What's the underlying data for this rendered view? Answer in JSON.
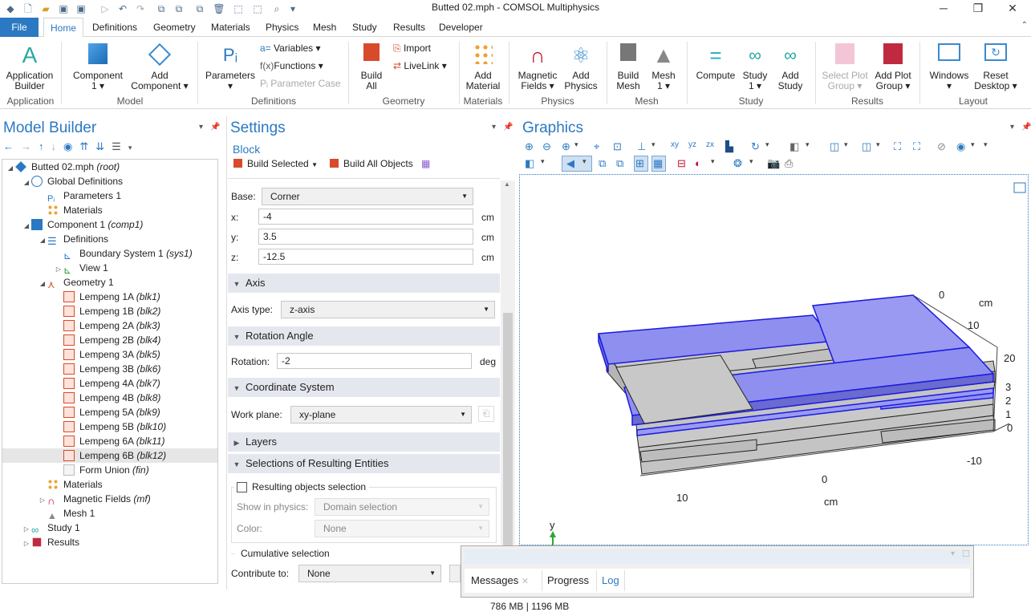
{
  "window": {
    "title": "Butted 02.mph - COMSOL Multiphysics",
    "minimize": "─",
    "restore": "❐",
    "close": "✕"
  },
  "menu": {
    "file": "File",
    "tabs": [
      "Home",
      "Definitions",
      "Geometry",
      "Materials",
      "Physics",
      "Mesh",
      "Study",
      "Results",
      "Developer"
    ]
  },
  "ribbon": {
    "buttons": {
      "app_builder": "Application\nBuilder",
      "component": "Component\n1 ▾",
      "add_component": "Add\nComponent ▾",
      "parameters": "Parameters\n▾",
      "variables": "Variables ▾",
      "functions": "Functions ▾",
      "parameter_case": "Parameter Case",
      "build_all": "Build\nAll",
      "import": "Import",
      "livelink": "LiveLink ▾",
      "add_material": "Add\nMaterial",
      "magnetic_fields": "Magnetic\nFields ▾",
      "add_physics": "Add\nPhysics",
      "build_mesh": "Build\nMesh",
      "mesh1": "Mesh\n1 ▾",
      "compute": "Compute",
      "study1": "Study\n1 ▾",
      "add_study": "Add\nStudy",
      "select_plot_group": "Select Plot\nGroup ▾",
      "add_plot_group": "Add Plot\nGroup ▾",
      "windows": "Windows\n▾",
      "reset_desktop": "Reset\nDesktop ▾"
    },
    "groups": [
      "Application",
      "Model",
      "Definitions",
      "Geometry",
      "Materials",
      "Physics",
      "Mesh",
      "Study",
      "Results",
      "Layout"
    ]
  },
  "model_builder": {
    "title": "Model Builder",
    "tree": [
      {
        "label": "Butted 02.mph",
        "tag": "(root)"
      },
      {
        "label": "Global Definitions",
        "tag": ""
      },
      {
        "label": "Parameters 1",
        "tag": ""
      },
      {
        "label": "Materials",
        "tag": ""
      },
      {
        "label": "Component 1",
        "tag": "(comp1)"
      },
      {
        "label": "Definitions",
        "tag": ""
      },
      {
        "label": "Boundary System 1",
        "tag": "(sys1)"
      },
      {
        "label": "View 1",
        "tag": ""
      },
      {
        "label": "Geometry 1",
        "tag": ""
      },
      {
        "label": "Lempeng  1A",
        "tag": "(blk1)"
      },
      {
        "label": "Lempeng  1B",
        "tag": "(blk2)"
      },
      {
        "label": "Lempeng 2A",
        "tag": "(blk3)"
      },
      {
        "label": "Lempeng 2B",
        "tag": "(blk4)"
      },
      {
        "label": "Lempeng 3A",
        "tag": "(blk5)"
      },
      {
        "label": "Lempeng 3B",
        "tag": "(blk6)"
      },
      {
        "label": "Lempeng 4A",
        "tag": "(blk7)"
      },
      {
        "label": "Lempeng 4B",
        "tag": "(blk8)"
      },
      {
        "label": "Lempeng 5A",
        "tag": "(blk9)"
      },
      {
        "label": "Lempeng 5B",
        "tag": "(blk10)"
      },
      {
        "label": "Lempeng 6A",
        "tag": "(blk11)"
      },
      {
        "label": "Lempeng 6B",
        "tag": "(blk12)"
      },
      {
        "label": "Form Union",
        "tag": "(fin)"
      },
      {
        "label": "Materials",
        "tag": ""
      },
      {
        "label": "Magnetic Fields",
        "tag": "(mf)"
      },
      {
        "label": "Mesh 1",
        "tag": ""
      },
      {
        "label": "Study 1",
        "tag": ""
      },
      {
        "label": "Results",
        "tag": ""
      }
    ]
  },
  "settings": {
    "title": "Settings",
    "subtitle": "Block",
    "build_selected": "Build Selected",
    "build_all_objects": "Build All Objects",
    "base_label": "Base:",
    "base_value": "Corner",
    "x_label": "x:",
    "x_value": "-4",
    "y_label": "y:",
    "y_value": "3.5",
    "z_label": "z:",
    "z_value": "-12.5",
    "unit_cm": "cm",
    "axis_section": "Axis",
    "axis_type_label": "Axis type:",
    "axis_type_value": "z-axis",
    "rotation_section": "Rotation Angle",
    "rotation_label": "Rotation:",
    "rotation_value": "-2",
    "rotation_unit": "deg",
    "coord_section": "Coordinate System",
    "work_plane_label": "Work plane:",
    "work_plane_value": "xy-plane",
    "layers_section": "Layers",
    "selections_section": "Selections of Resulting Entities",
    "resulting_selection": "Resulting objects selection",
    "show_in_physics_label": "Show in physics:",
    "show_in_physics_value": "Domain selection",
    "color_label": "Color:",
    "color_value": "None",
    "cumulative": "Cumulative selection",
    "contribute_label": "Contribute to:",
    "contribute_value": "None"
  },
  "graphics": {
    "title": "Graphics",
    "axis_labels": {
      "z0": "0",
      "zcm": "cm",
      "z10": "10",
      "z20": "20",
      "y3": "3",
      "y2": "2",
      "y1": "1",
      "y0": "0",
      "xm10": "-10",
      "x0": "0",
      "x10": "10",
      "xcm": "cm",
      "triad_y": "y"
    },
    "colors": {
      "selected": "#8f8ff0",
      "gray": "#c4c4c4",
      "edge": "#2222dd"
    }
  },
  "messages": {
    "tabs": [
      "Messages",
      "Progress",
      "Log"
    ]
  },
  "status": {
    "memory": "786 MB | 1196 MB"
  }
}
